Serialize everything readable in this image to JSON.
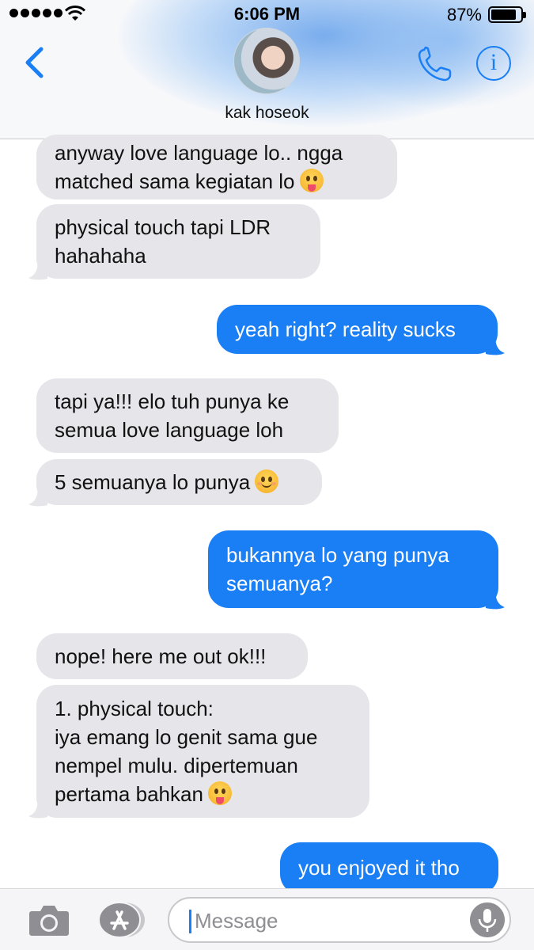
{
  "status_bar": {
    "time": "6:06 PM",
    "battery_percent": "87%",
    "battery_level": 0.87,
    "signal_dots": 5
  },
  "header": {
    "contact_name": "kak hoseok",
    "icons": [
      "back-chevron-icon",
      "avatar-photo",
      "phone-icon",
      "info-icon"
    ],
    "info_glyph": "i",
    "accent_color": "#1a7ef5"
  },
  "messages": [
    {
      "side": "received",
      "text": "anyway love language lo.. ngga\nmatched sama kegiatan lo",
      "emoji": "tongue-out-emoji"
    },
    {
      "side": "received",
      "text": "physical touch tapi LDR\nhahahaha"
    },
    {
      "side": "sent",
      "text": "yeah right? reality sucks"
    },
    {
      "side": "received",
      "text": "tapi ya!!! elo tuh punya ke\nsemua love language loh"
    },
    {
      "side": "received",
      "text": "5 semuanya lo punya",
      "emoji": "smiling-emoji"
    },
    {
      "side": "sent",
      "text": "bukannya lo yang punya\nsemuanya?"
    },
    {
      "side": "received",
      "text": "nope! here me out ok!!!"
    },
    {
      "side": "received",
      "text": "1. physical touch:\niya emang lo genit sama gue\nnempel mulu. dipertemuan\npertama bahkan",
      "emoji": "tongue-out-emoji"
    },
    {
      "side": "sent",
      "text": "you enjoyed it tho"
    }
  ],
  "colors": {
    "sent_bubble": "#1a7ef5",
    "received_bubble": "#e5e5ea"
  },
  "input_bar": {
    "placeholder": "Message",
    "icons": [
      "camera-icon",
      "app-store-icon",
      "microphone-icon"
    ]
  }
}
